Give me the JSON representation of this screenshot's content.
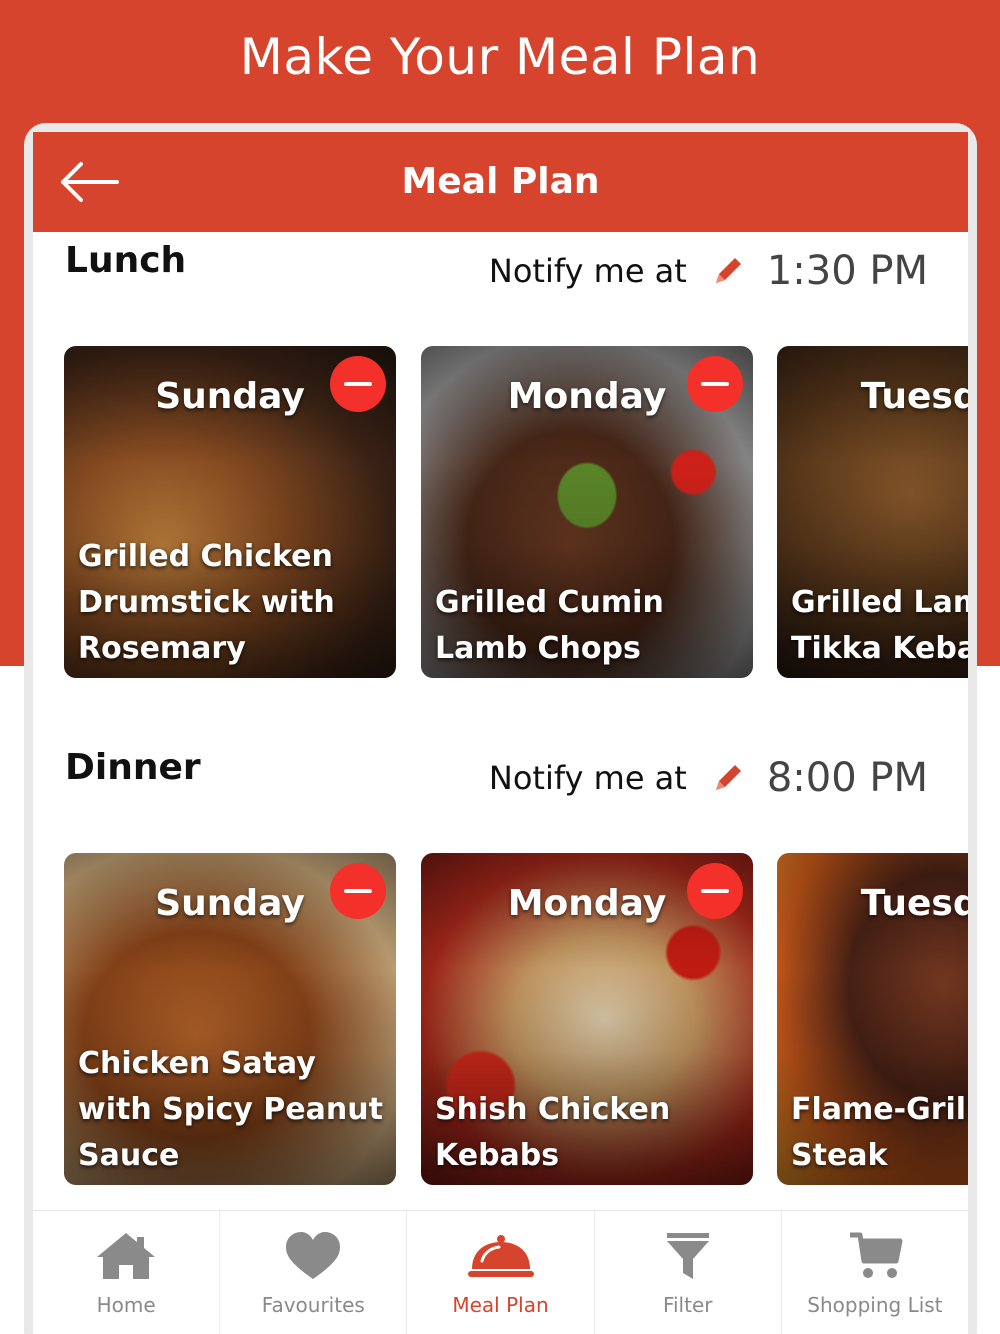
{
  "headline": "Make Your Meal Plan",
  "navbar": {
    "title": "Meal Plan"
  },
  "colors": {
    "brand": "#d7442d",
    "remove": "#f4302b",
    "inactive": "#8a8a8a"
  },
  "sections": [
    {
      "title": "Lunch",
      "notify_label": "Notify me at",
      "time": "1:30 PM",
      "cards": [
        {
          "day": "Sunday",
          "name": "Grilled Chicken Drumstick with Rosemary"
        },
        {
          "day": "Monday",
          "name": "Grilled Cumin Lamb Chops"
        },
        {
          "day": "Tuesday",
          "name": "Grilled Lamb Tikka Kebab"
        }
      ]
    },
    {
      "title": "Dinner",
      "notify_label": "Notify me at",
      "time": "8:00 PM",
      "cards": [
        {
          "day": "Sunday",
          "name": "Chicken Satay with Spicy Peanut Sauce"
        },
        {
          "day": "Monday",
          "name": "Shish Chicken Kebabs"
        },
        {
          "day": "Tuesday",
          "name": "Flame-Grilled Steak"
        }
      ]
    }
  ],
  "tabs": [
    {
      "label": "Home",
      "icon": "home-icon"
    },
    {
      "label": "Favourites",
      "icon": "heart-icon"
    },
    {
      "label": "Meal Plan",
      "icon": "cloche-icon"
    },
    {
      "label": "Filter",
      "icon": "filter-icon"
    },
    {
      "label": "Shopping List",
      "icon": "cart-icon"
    }
  ]
}
